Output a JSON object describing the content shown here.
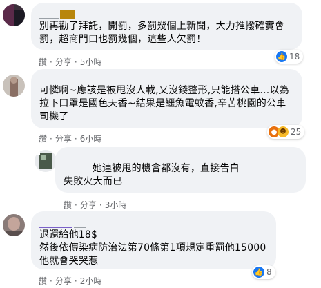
{
  "colors": {
    "bubble": "#f0f2f5",
    "like": "#1877f2",
    "meta_text": "#65676b"
  },
  "comments": [
    {
      "text": "別再勸了拜託，開罰，多罰幾個上新聞，大力推撥確實會\n罰，超商門口也罰幾個，這些人欠罰！",
      "actions": {
        "like": "讚",
        "share": "分享",
        "time": "5小時"
      },
      "reaction": {
        "icons": [
          "like-icon"
        ],
        "count": "18"
      }
    },
    {
      "text": "可憐啊~應該是被甩沒人載,又沒錢整形,只能搭公車...以為\n拉下口罩是國色天香~結果是鱷魚電蚊香,辛苦桃園的公車\n司機了",
      "actions": {
        "like": "讚",
        "share": "分享",
        "time": "6小時"
      },
      "reaction": {
        "icons": [
          "angry-icon",
          "haha-icon"
        ],
        "count": "25"
      }
    },
    {
      "text": "         她連被甩的機會都沒有，直接告白\n失敗火大而已",
      "actions": {
        "like": "讚",
        "share": "分享",
        "time": "3小時"
      }
    },
    {
      "text": "退還給他18$\n然後依傳染病防治法第70條第1項規定重罰他15000\n他就會哭哭惹",
      "actions": {
        "like": "讚",
        "share": "分享",
        "time": "2小時"
      },
      "reaction": {
        "icons": [
          "like-icon"
        ],
        "count": "8"
      }
    }
  ]
}
